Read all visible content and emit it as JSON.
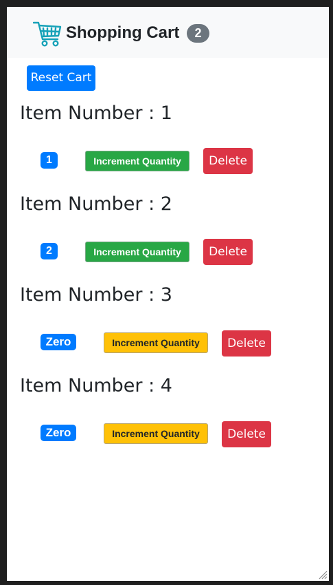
{
  "navbar": {
    "icon": "shopping-cart-icon",
    "title": "Shopping Cart",
    "count": "2"
  },
  "reset_label": "Reset Cart",
  "items": [
    {
      "heading": "Item Number : 1",
      "quantity": "1",
      "increment_label": "Increment Quantity",
      "delete_label": "Delete",
      "increment_color": "#28a745"
    },
    {
      "heading": "Item Number : 2",
      "quantity": "2",
      "increment_label": "Increment Quantity",
      "delete_label": "Delete",
      "increment_color": "#28a745"
    },
    {
      "heading": "Item Number : 3",
      "quantity": "Zero",
      "increment_label": "Increment Quantity",
      "delete_label": "Delete",
      "increment_color": "#ffc107"
    },
    {
      "heading": "Item Number : 4",
      "quantity": "Zero",
      "increment_label": "Increment Quantity",
      "delete_label": "Delete",
      "increment_color": "#ffc107"
    }
  ],
  "colors": {
    "primary": "#007bff",
    "secondary": "#6c757d",
    "success": "#28a745",
    "warning": "#ffc107",
    "danger": "#dc3545",
    "icon": "#17a2b8"
  }
}
